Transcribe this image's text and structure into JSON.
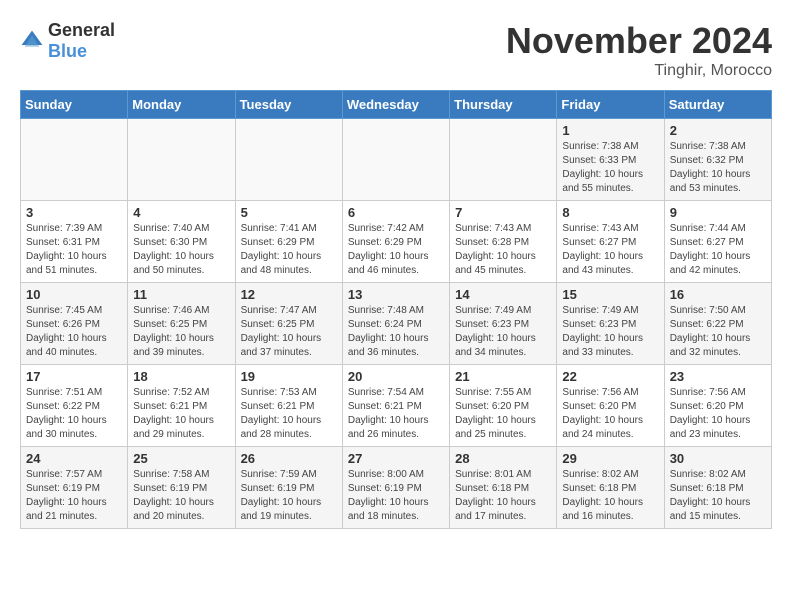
{
  "header": {
    "logo_general": "General",
    "logo_blue": "Blue",
    "month": "November 2024",
    "location": "Tinghir, Morocco"
  },
  "weekdays": [
    "Sunday",
    "Monday",
    "Tuesday",
    "Wednesday",
    "Thursday",
    "Friday",
    "Saturday"
  ],
  "weeks": [
    [
      {
        "day": "",
        "info": ""
      },
      {
        "day": "",
        "info": ""
      },
      {
        "day": "",
        "info": ""
      },
      {
        "day": "",
        "info": ""
      },
      {
        "day": "",
        "info": ""
      },
      {
        "day": "1",
        "info": "Sunrise: 7:38 AM\nSunset: 6:33 PM\nDaylight: 10 hours\nand 55 minutes."
      },
      {
        "day": "2",
        "info": "Sunrise: 7:38 AM\nSunset: 6:32 PM\nDaylight: 10 hours\nand 53 minutes."
      }
    ],
    [
      {
        "day": "3",
        "info": "Sunrise: 7:39 AM\nSunset: 6:31 PM\nDaylight: 10 hours\nand 51 minutes."
      },
      {
        "day": "4",
        "info": "Sunrise: 7:40 AM\nSunset: 6:30 PM\nDaylight: 10 hours\nand 50 minutes."
      },
      {
        "day": "5",
        "info": "Sunrise: 7:41 AM\nSunset: 6:29 PM\nDaylight: 10 hours\nand 48 minutes."
      },
      {
        "day": "6",
        "info": "Sunrise: 7:42 AM\nSunset: 6:29 PM\nDaylight: 10 hours\nand 46 minutes."
      },
      {
        "day": "7",
        "info": "Sunrise: 7:43 AM\nSunset: 6:28 PM\nDaylight: 10 hours\nand 45 minutes."
      },
      {
        "day": "8",
        "info": "Sunrise: 7:43 AM\nSunset: 6:27 PM\nDaylight: 10 hours\nand 43 minutes."
      },
      {
        "day": "9",
        "info": "Sunrise: 7:44 AM\nSunset: 6:27 PM\nDaylight: 10 hours\nand 42 minutes."
      }
    ],
    [
      {
        "day": "10",
        "info": "Sunrise: 7:45 AM\nSunset: 6:26 PM\nDaylight: 10 hours\nand 40 minutes."
      },
      {
        "day": "11",
        "info": "Sunrise: 7:46 AM\nSunset: 6:25 PM\nDaylight: 10 hours\nand 39 minutes."
      },
      {
        "day": "12",
        "info": "Sunrise: 7:47 AM\nSunset: 6:25 PM\nDaylight: 10 hours\nand 37 minutes."
      },
      {
        "day": "13",
        "info": "Sunrise: 7:48 AM\nSunset: 6:24 PM\nDaylight: 10 hours\nand 36 minutes."
      },
      {
        "day": "14",
        "info": "Sunrise: 7:49 AM\nSunset: 6:23 PM\nDaylight: 10 hours\nand 34 minutes."
      },
      {
        "day": "15",
        "info": "Sunrise: 7:49 AM\nSunset: 6:23 PM\nDaylight: 10 hours\nand 33 minutes."
      },
      {
        "day": "16",
        "info": "Sunrise: 7:50 AM\nSunset: 6:22 PM\nDaylight: 10 hours\nand 32 minutes."
      }
    ],
    [
      {
        "day": "17",
        "info": "Sunrise: 7:51 AM\nSunset: 6:22 PM\nDaylight: 10 hours\nand 30 minutes."
      },
      {
        "day": "18",
        "info": "Sunrise: 7:52 AM\nSunset: 6:21 PM\nDaylight: 10 hours\nand 29 minutes."
      },
      {
        "day": "19",
        "info": "Sunrise: 7:53 AM\nSunset: 6:21 PM\nDaylight: 10 hours\nand 28 minutes."
      },
      {
        "day": "20",
        "info": "Sunrise: 7:54 AM\nSunset: 6:21 PM\nDaylight: 10 hours\nand 26 minutes."
      },
      {
        "day": "21",
        "info": "Sunrise: 7:55 AM\nSunset: 6:20 PM\nDaylight: 10 hours\nand 25 minutes."
      },
      {
        "day": "22",
        "info": "Sunrise: 7:56 AM\nSunset: 6:20 PM\nDaylight: 10 hours\nand 24 minutes."
      },
      {
        "day": "23",
        "info": "Sunrise: 7:56 AM\nSunset: 6:20 PM\nDaylight: 10 hours\nand 23 minutes."
      }
    ],
    [
      {
        "day": "24",
        "info": "Sunrise: 7:57 AM\nSunset: 6:19 PM\nDaylight: 10 hours\nand 21 minutes."
      },
      {
        "day": "25",
        "info": "Sunrise: 7:58 AM\nSunset: 6:19 PM\nDaylight: 10 hours\nand 20 minutes."
      },
      {
        "day": "26",
        "info": "Sunrise: 7:59 AM\nSunset: 6:19 PM\nDaylight: 10 hours\nand 19 minutes."
      },
      {
        "day": "27",
        "info": "Sunrise: 8:00 AM\nSunset: 6:19 PM\nDaylight: 10 hours\nand 18 minutes."
      },
      {
        "day": "28",
        "info": "Sunrise: 8:01 AM\nSunset: 6:18 PM\nDaylight: 10 hours\nand 17 minutes."
      },
      {
        "day": "29",
        "info": "Sunrise: 8:02 AM\nSunset: 6:18 PM\nDaylight: 10 hours\nand 16 minutes."
      },
      {
        "day": "30",
        "info": "Sunrise: 8:02 AM\nSunset: 6:18 PM\nDaylight: 10 hours\nand 15 minutes."
      }
    ]
  ]
}
